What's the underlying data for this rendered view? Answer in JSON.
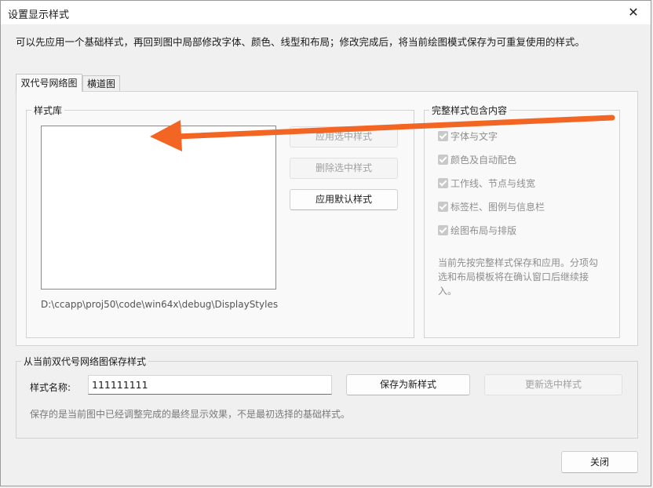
{
  "window": {
    "title": "设置显示样式",
    "close_glyph": "✕"
  },
  "intro": "可以先应用一个基础样式，再回到图中局部修改字体、颜色、线型和布局；修改完成后，将当前绘图模式保存为可重复使用的样式。",
  "tabs": [
    {
      "label": "双代号网络图",
      "active": true
    },
    {
      "label": "横道图",
      "active": false
    }
  ],
  "library": {
    "label": "样式库",
    "path": "D:\\ccapp\\proj50\\code\\win64x\\debug\\DisplayStyles",
    "buttons": {
      "apply_selected": "应用选中样式",
      "delete_selected": "删除选中样式",
      "apply_default": "应用默认样式"
    }
  },
  "contents": {
    "label": "完整样式包含内容",
    "items": [
      "字体与文字",
      "颜色及自动配色",
      "工作线、节点与线宽",
      "标签栏、图例与信息栏",
      "绘图布局与排版"
    ],
    "note": "当前先按完整样式保存和应用。分项勾选和布局模板将在确认窗口后继续接入。"
  },
  "save": {
    "label": "从当前双代号网络图保存样式",
    "name_label": "样式名称:",
    "name_value": "111111111",
    "save_new": "保存为新样式",
    "update_selected": "更新选中样式",
    "note": "保存的是当前图中已经调整完成的最终显示效果，不是最初选择的基础样式。"
  },
  "footer": {
    "close": "关闭"
  },
  "colors": {
    "arrow": "#f26522",
    "window_bg": "#f0f0f0"
  }
}
